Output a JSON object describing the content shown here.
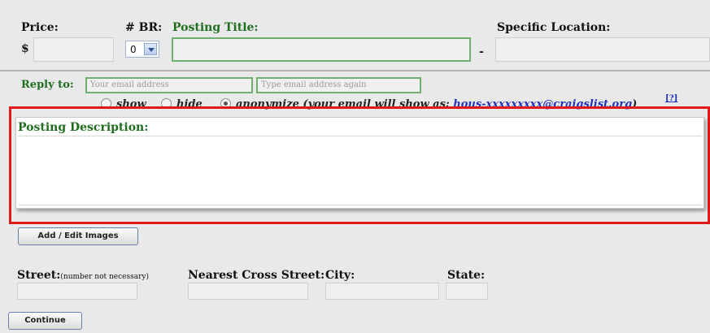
{
  "price": {
    "label": "Price:",
    "currency": "$",
    "value": ""
  },
  "bedrooms": {
    "label": "# BR:",
    "value": "0"
  },
  "posting_title": {
    "label": "Posting Title:",
    "value": ""
  },
  "dash": "-",
  "specific_location": {
    "label": "Specific Location:",
    "value": ""
  },
  "reply_to": {
    "label": "Reply to:",
    "email_placeholder": "Your email address",
    "email_again_placeholder": "Type email address again"
  },
  "email_privacy": {
    "show_label": "show",
    "hide_label": "hide",
    "anonymize_label": "anonymize (your email will show as:",
    "anon_email": "hous-xxxxxxxxx@craigslist.org",
    "closing": ")",
    "help_link": "[?]"
  },
  "description": {
    "label": "Posting Description:",
    "value": ""
  },
  "buttons": {
    "images": "Add / Edit Images",
    "continue": "Continue"
  },
  "address": {
    "street_label": "Street:",
    "street_note": "(number not necessary)",
    "cross_street_label": "Nearest Cross Street:",
    "city_label": "City:",
    "state_label": "State:"
  },
  "colors": {
    "accent_green": "#1f6e1f",
    "highlight_red": "#e11818",
    "link_blue": "#2233bb"
  }
}
